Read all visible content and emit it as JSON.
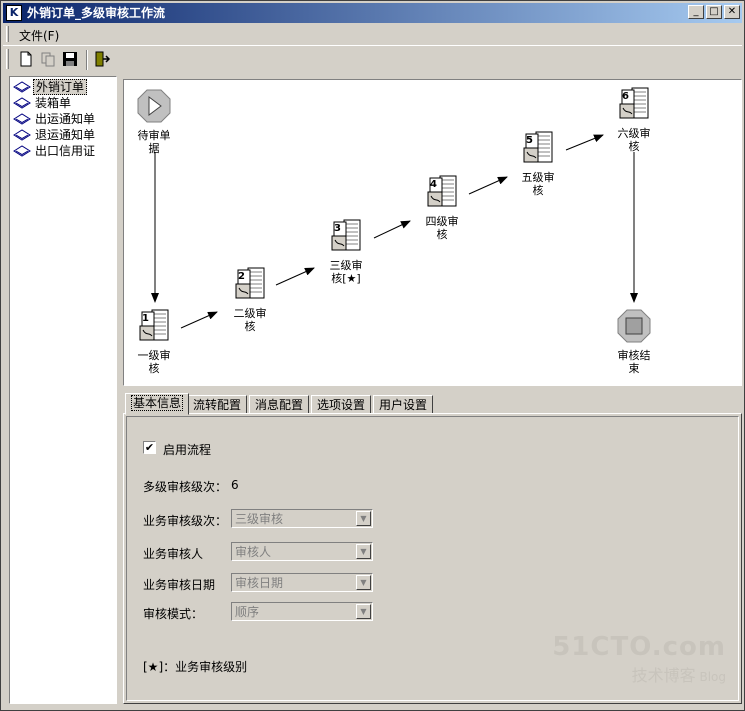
{
  "window": {
    "title": "外销订单_多级审核工作流",
    "min": "_",
    "max": "□",
    "close": "✕"
  },
  "menu": {
    "file": "文件(F)"
  },
  "toolbar": {
    "icons": [
      "new-icon",
      "copy-icon",
      "save-icon",
      "exit-icon"
    ]
  },
  "tree": {
    "items": [
      "外销订单",
      "装箱单",
      "出运通知单",
      "退运通知单",
      "出口信用证"
    ],
    "selected": 0
  },
  "workflow": {
    "start": {
      "label1": "待审单",
      "label2": "据"
    },
    "end": {
      "label1": "审核结",
      "label2": "束"
    },
    "steps": [
      {
        "num": "1",
        "label1": "一级审",
        "label2": "核"
      },
      {
        "num": "2",
        "label1": "二级审",
        "label2": "核"
      },
      {
        "num": "3",
        "label1": "三级审",
        "label2": "核[★]"
      },
      {
        "num": "4",
        "label1": "四级审",
        "label2": "核"
      },
      {
        "num": "5",
        "label1": "五级审",
        "label2": "核"
      },
      {
        "num": "6",
        "label1": "六级审",
        "label2": "核"
      }
    ]
  },
  "tabs": [
    "基本信息",
    "流转配置",
    "消息配置",
    "选项设置",
    "用户设置"
  ],
  "form": {
    "enable_label": "启用流程",
    "enable_checked": "✔",
    "levels_label": "多级审核级次：",
    "levels_value": "6",
    "biz_level_label": "业务审核级次：",
    "biz_level_value": "三级审核",
    "reviewer_label": "业务审核人",
    "reviewer_value": "审核人",
    "date_label": "业务审核日期",
    "date_value": "审核日期",
    "mode_label": "审核模式：",
    "mode_value": "顺序",
    "note": "[★]：业务审核级别"
  },
  "watermark": {
    "line1": "51CTO.com",
    "line2": "技术博客",
    "line3": "Blog"
  }
}
